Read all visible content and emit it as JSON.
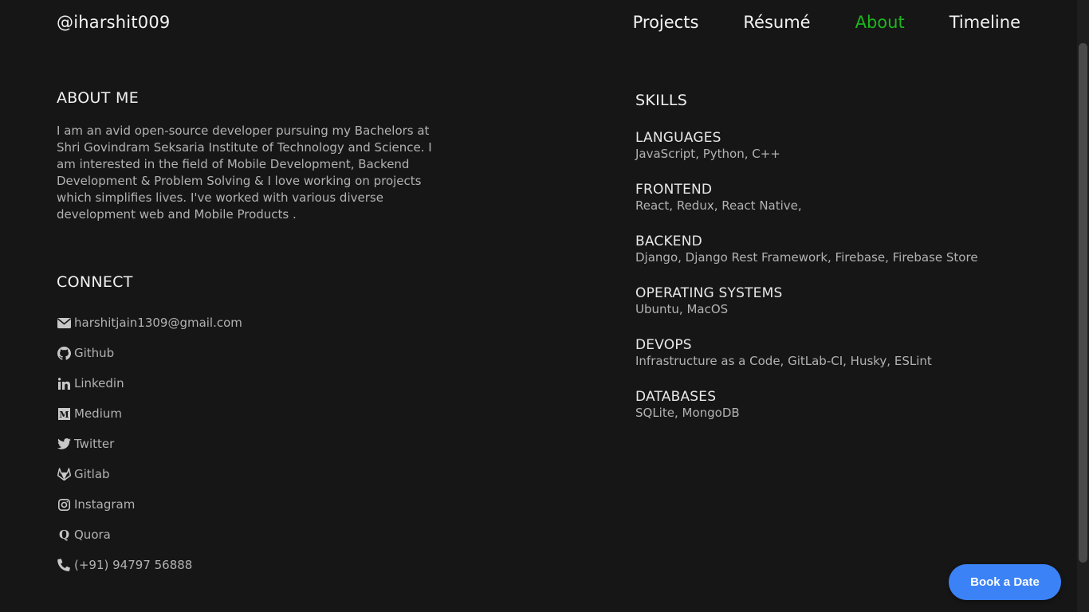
{
  "header": {
    "logo": "@iharshit009",
    "nav": [
      {
        "label": "Projects",
        "active": false
      },
      {
        "label": "Résumé",
        "active": false
      },
      {
        "label": "About",
        "active": true
      },
      {
        "label": "Timeline",
        "active": false
      }
    ]
  },
  "about": {
    "title": "ABOUT ME",
    "text": "I am an avid open-source developer pursuing my Bachelors at Shri Govindram Seksaria Institute of Technology and Science. I am interested in the field of Mobile Development, Backend Development & Problem Solving & I love working on projects which simplifies lives. I've worked with various diverse development web and Mobile Products ."
  },
  "connect": {
    "title": "CONNECT",
    "items": [
      {
        "icon": "envelope-icon",
        "label": "harshitjain1309@gmail.com"
      },
      {
        "icon": "github-icon",
        "label": "Github"
      },
      {
        "icon": "linkedin-icon",
        "label": "Linkedin"
      },
      {
        "icon": "medium-icon",
        "label": "Medium"
      },
      {
        "icon": "twitter-icon",
        "label": "Twitter"
      },
      {
        "icon": "gitlab-icon",
        "label": "Gitlab"
      },
      {
        "icon": "instagram-icon",
        "label": "Instagram"
      },
      {
        "icon": "quora-icon",
        "label": "Quora"
      },
      {
        "icon": "phone-icon",
        "label": "(+91) 94797 56888"
      }
    ]
  },
  "skills": {
    "title": "SKILLS",
    "groups": [
      {
        "name": "LANGUAGES",
        "values": "JavaScript, Python, C++"
      },
      {
        "name": "FRONTEND",
        "values": "React, Redux, React Native,"
      },
      {
        "name": "BACKEND",
        "values": "Django, Django Rest Framework, Firebase, Firebase Store"
      },
      {
        "name": "OPERATING SYSTEMS",
        "values": "Ubuntu, MacOS"
      },
      {
        "name": "DEVOPS",
        "values": "Infrastructure as a Code, GitLab-CI, Husky, ESLint"
      },
      {
        "name": "DATABASES",
        "values": "SQLite, MongoDB"
      }
    ]
  },
  "cta": {
    "label": "Book a Date"
  },
  "colors": {
    "background": "#161616",
    "active_nav": "#1cb71c",
    "cta": "#3b82f6"
  }
}
